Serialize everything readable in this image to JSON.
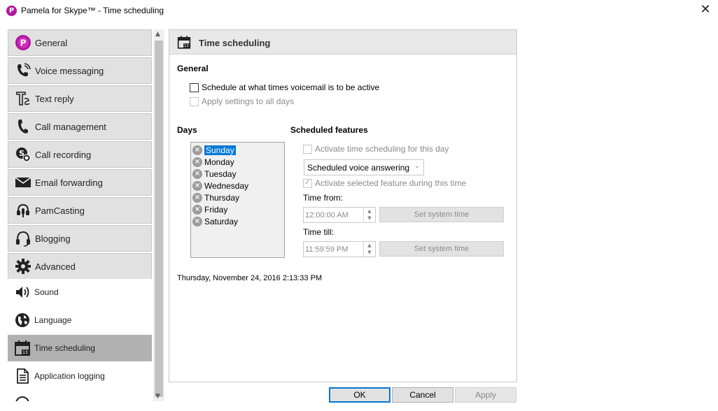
{
  "window": {
    "app_icon": "P",
    "title": "Pamela for Skype™ - Time scheduling",
    "close_glyph": "✕"
  },
  "nav": {
    "sections": [
      {
        "label": "General",
        "icon": "pamela-logo-icon"
      },
      {
        "label": "Voice messaging",
        "icon": "phone-wave-icon"
      },
      {
        "label": "Text reply",
        "icon": "text-reply-icon"
      },
      {
        "label": "Call management",
        "icon": "phone-icon"
      },
      {
        "label": "Call recording",
        "icon": "skype-record-icon"
      },
      {
        "label": "Email forwarding",
        "icon": "envelope-icon"
      },
      {
        "label": "PamCasting",
        "icon": "microphone-headset-icon"
      },
      {
        "label": "Blogging",
        "icon": "headset-icon"
      },
      {
        "label": "Advanced",
        "icon": "gear-icon"
      }
    ],
    "sub_items": [
      {
        "label": "Sound",
        "icon": "speaker-icon"
      },
      {
        "label": "Language",
        "icon": "globe-icon"
      },
      {
        "label": "Time scheduling",
        "icon": "calendar-icon"
      },
      {
        "label": "Application logging",
        "icon": "document-icon"
      }
    ],
    "selected": "Time scheduling"
  },
  "panel": {
    "title": "Time scheduling",
    "general": {
      "title": "General",
      "schedule_checkbox": "Schedule at what times voicemail is to be active",
      "apply_all_checkbox": "Apply settings to all days"
    },
    "days": {
      "title": "Days",
      "items": [
        "Sunday",
        "Monday",
        "Tuesday",
        "Wednesday",
        "Thursday",
        "Friday",
        "Saturday"
      ],
      "selected": "Sunday"
    },
    "features": {
      "title": "Scheduled features",
      "activate_day_checkbox": "Activate time scheduling for this day",
      "feature_select": "Scheduled voice answering",
      "activate_feature_checkbox": "Activate selected feature during this time",
      "time_from_label": "Time from:",
      "time_from_value": "12:00:00 AM",
      "time_till_label": "Time till:",
      "time_till_value": "11:59:59 PM",
      "set_system_time": "Set system time"
    },
    "current_datetime": "Thursday, November 24, 2016 2:13:33 PM"
  },
  "buttons": {
    "ok": "OK",
    "cancel": "Cancel",
    "apply": "Apply"
  },
  "colors": {
    "brand": "#b0169c",
    "selection": "#0078d7",
    "nav_selected": "#b1b1b1"
  }
}
